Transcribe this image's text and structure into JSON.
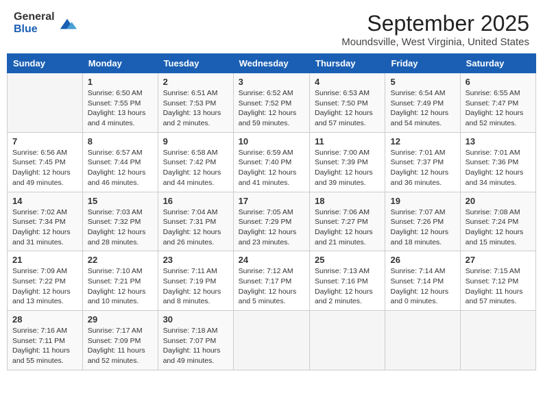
{
  "logo": {
    "general": "General",
    "blue": "Blue"
  },
  "title": "September 2025",
  "location": "Moundsville, West Virginia, United States",
  "days_of_week": [
    "Sunday",
    "Monday",
    "Tuesday",
    "Wednesday",
    "Thursday",
    "Friday",
    "Saturday"
  ],
  "weeks": [
    [
      {
        "day": "",
        "sunrise": "",
        "sunset": "",
        "daylight": ""
      },
      {
        "day": "1",
        "sunrise": "Sunrise: 6:50 AM",
        "sunset": "Sunset: 7:55 PM",
        "daylight": "Daylight: 13 hours and 4 minutes."
      },
      {
        "day": "2",
        "sunrise": "Sunrise: 6:51 AM",
        "sunset": "Sunset: 7:53 PM",
        "daylight": "Daylight: 13 hours and 2 minutes."
      },
      {
        "day": "3",
        "sunrise": "Sunrise: 6:52 AM",
        "sunset": "Sunset: 7:52 PM",
        "daylight": "Daylight: 12 hours and 59 minutes."
      },
      {
        "day": "4",
        "sunrise": "Sunrise: 6:53 AM",
        "sunset": "Sunset: 7:50 PM",
        "daylight": "Daylight: 12 hours and 57 minutes."
      },
      {
        "day": "5",
        "sunrise": "Sunrise: 6:54 AM",
        "sunset": "Sunset: 7:49 PM",
        "daylight": "Daylight: 12 hours and 54 minutes."
      },
      {
        "day": "6",
        "sunrise": "Sunrise: 6:55 AM",
        "sunset": "Sunset: 7:47 PM",
        "daylight": "Daylight: 12 hours and 52 minutes."
      }
    ],
    [
      {
        "day": "7",
        "sunrise": "Sunrise: 6:56 AM",
        "sunset": "Sunset: 7:45 PM",
        "daylight": "Daylight: 12 hours and 49 minutes."
      },
      {
        "day": "8",
        "sunrise": "Sunrise: 6:57 AM",
        "sunset": "Sunset: 7:44 PM",
        "daylight": "Daylight: 12 hours and 46 minutes."
      },
      {
        "day": "9",
        "sunrise": "Sunrise: 6:58 AM",
        "sunset": "Sunset: 7:42 PM",
        "daylight": "Daylight: 12 hours and 44 minutes."
      },
      {
        "day": "10",
        "sunrise": "Sunrise: 6:59 AM",
        "sunset": "Sunset: 7:40 PM",
        "daylight": "Daylight: 12 hours and 41 minutes."
      },
      {
        "day": "11",
        "sunrise": "Sunrise: 7:00 AM",
        "sunset": "Sunset: 7:39 PM",
        "daylight": "Daylight: 12 hours and 39 minutes."
      },
      {
        "day": "12",
        "sunrise": "Sunrise: 7:01 AM",
        "sunset": "Sunset: 7:37 PM",
        "daylight": "Daylight: 12 hours and 36 minutes."
      },
      {
        "day": "13",
        "sunrise": "Sunrise: 7:01 AM",
        "sunset": "Sunset: 7:36 PM",
        "daylight": "Daylight: 12 hours and 34 minutes."
      }
    ],
    [
      {
        "day": "14",
        "sunrise": "Sunrise: 7:02 AM",
        "sunset": "Sunset: 7:34 PM",
        "daylight": "Daylight: 12 hours and 31 minutes."
      },
      {
        "day": "15",
        "sunrise": "Sunrise: 7:03 AM",
        "sunset": "Sunset: 7:32 PM",
        "daylight": "Daylight: 12 hours and 28 minutes."
      },
      {
        "day": "16",
        "sunrise": "Sunrise: 7:04 AM",
        "sunset": "Sunset: 7:31 PM",
        "daylight": "Daylight: 12 hours and 26 minutes."
      },
      {
        "day": "17",
        "sunrise": "Sunrise: 7:05 AM",
        "sunset": "Sunset: 7:29 PM",
        "daylight": "Daylight: 12 hours and 23 minutes."
      },
      {
        "day": "18",
        "sunrise": "Sunrise: 7:06 AM",
        "sunset": "Sunset: 7:27 PM",
        "daylight": "Daylight: 12 hours and 21 minutes."
      },
      {
        "day": "19",
        "sunrise": "Sunrise: 7:07 AM",
        "sunset": "Sunset: 7:26 PM",
        "daylight": "Daylight: 12 hours and 18 minutes."
      },
      {
        "day": "20",
        "sunrise": "Sunrise: 7:08 AM",
        "sunset": "Sunset: 7:24 PM",
        "daylight": "Daylight: 12 hours and 15 minutes."
      }
    ],
    [
      {
        "day": "21",
        "sunrise": "Sunrise: 7:09 AM",
        "sunset": "Sunset: 7:22 PM",
        "daylight": "Daylight: 12 hours and 13 minutes."
      },
      {
        "day": "22",
        "sunrise": "Sunrise: 7:10 AM",
        "sunset": "Sunset: 7:21 PM",
        "daylight": "Daylight: 12 hours and 10 minutes."
      },
      {
        "day": "23",
        "sunrise": "Sunrise: 7:11 AM",
        "sunset": "Sunset: 7:19 PM",
        "daylight": "Daylight: 12 hours and 8 minutes."
      },
      {
        "day": "24",
        "sunrise": "Sunrise: 7:12 AM",
        "sunset": "Sunset: 7:17 PM",
        "daylight": "Daylight: 12 hours and 5 minutes."
      },
      {
        "day": "25",
        "sunrise": "Sunrise: 7:13 AM",
        "sunset": "Sunset: 7:16 PM",
        "daylight": "Daylight: 12 hours and 2 minutes."
      },
      {
        "day": "26",
        "sunrise": "Sunrise: 7:14 AM",
        "sunset": "Sunset: 7:14 PM",
        "daylight": "Daylight: 12 hours and 0 minutes."
      },
      {
        "day": "27",
        "sunrise": "Sunrise: 7:15 AM",
        "sunset": "Sunset: 7:12 PM",
        "daylight": "Daylight: 11 hours and 57 minutes."
      }
    ],
    [
      {
        "day": "28",
        "sunrise": "Sunrise: 7:16 AM",
        "sunset": "Sunset: 7:11 PM",
        "daylight": "Daylight: 11 hours and 55 minutes."
      },
      {
        "day": "29",
        "sunrise": "Sunrise: 7:17 AM",
        "sunset": "Sunset: 7:09 PM",
        "daylight": "Daylight: 11 hours and 52 minutes."
      },
      {
        "day": "30",
        "sunrise": "Sunrise: 7:18 AM",
        "sunset": "Sunset: 7:07 PM",
        "daylight": "Daylight: 11 hours and 49 minutes."
      },
      {
        "day": "",
        "sunrise": "",
        "sunset": "",
        "daylight": ""
      },
      {
        "day": "",
        "sunrise": "",
        "sunset": "",
        "daylight": ""
      },
      {
        "day": "",
        "sunrise": "",
        "sunset": "",
        "daylight": ""
      },
      {
        "day": "",
        "sunrise": "",
        "sunset": "",
        "daylight": ""
      }
    ]
  ]
}
